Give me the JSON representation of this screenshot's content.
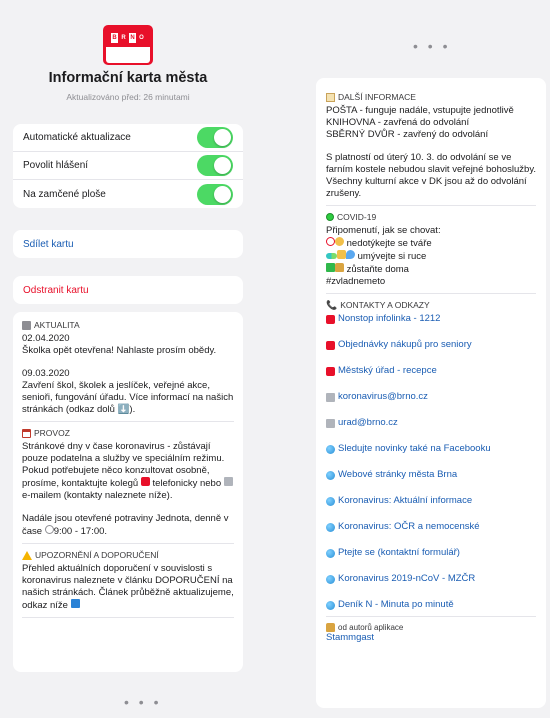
{
  "header": {
    "title": "Informační karta města",
    "updated": "Aktualizováno před: 26 minutami",
    "icon_letters": [
      "B",
      "R",
      "N",
      "O"
    ]
  },
  "settings": {
    "toggles": [
      {
        "label": "Automatické aktualizace",
        "on": true
      },
      {
        "label": "Povolit hlášení",
        "on": true
      },
      {
        "label": "Na zamčené ploše",
        "on": true
      }
    ]
  },
  "actions": {
    "share": "Sdílet kartu",
    "remove": "Odstranit kartu"
  },
  "sections": {
    "news": {
      "head": "AKTUALITA",
      "entries": [
        {
          "date": "02.04.2020",
          "text": "Školka opět otevřena! Nahlaste prosím obědy."
        },
        {
          "date": "09.03.2020",
          "text": "Zavření škol, školek a jeslíček, veřejné akce, senioři, fungování úřadu. Více informací na našich stránkách (odkaz dolů ⬇️)."
        }
      ]
    },
    "provoz": {
      "head": "PROVOZ",
      "p1": "Stránkové dny v čase koronavirus - zůstávají pouze podatelna a služby ve speciálním režimu.",
      "p2a": "Pokud potřebujete něco konzultovat osobně, prosíme, kontaktujte kolegů",
      "p2b": "telefonicky nebo",
      "p2c": "e-mailem (kontakty naleznete níže).",
      "p3a": "Nadále jsou otevřené potraviny Jednota, denně v čase",
      "p3b": "9:00 - 17:00."
    },
    "warning": {
      "head": "UPOZORNĚNÍ A DOPORUČENÍ",
      "text": "Přehled aktuálních doporučení v souvislosti s koronavirus naleznete v článku DOPORUČENÍ na našich stránkách. Článek průběžně aktualizujeme, odkaz níže"
    },
    "info": {
      "head": "DALŠÍ INFORMACE",
      "lines": [
        "POŠTA - funguje nadále, vstupujte jednotlivě",
        "KNIHOVNA - zavřená do odvolání",
        "SBĚRNÝ DVŮR - zavřený do odvolání"
      ],
      "p2": "S platností od úterý 10. 3. do odvolání se ve farním kostele nebudou slavit veřejné bohoslužby.",
      "p3": "Všechny kulturní akce v DK jsou až do odvolání zrušeny."
    },
    "covid": {
      "head": "COVID-19",
      "intro": "Připomenutí, jak se chovat:",
      "rule1": "nedotýkejte se tváře",
      "rule2": "umývejte si ruce",
      "rule3": "zůstaňte doma",
      "tag": "#zvladnemeto"
    },
    "contacts": {
      "head": "KONTAKTY A ODKAZY",
      "links": [
        {
          "icon": "tel",
          "label": "Nonstop infolinka - 1212"
        },
        {
          "icon": "tel",
          "label": "Objednávky nákupů pro seniory"
        },
        {
          "icon": "tel",
          "label": "Městský úřad - recepce"
        },
        {
          "icon": "mail",
          "label": "koronavirus@brno.cz"
        },
        {
          "icon": "mail",
          "label": "urad@brno.cz"
        },
        {
          "icon": "globe",
          "label": "Sledujte novinky také na Facebooku"
        },
        {
          "icon": "globe",
          "label": "Webové stránky města Brna"
        },
        {
          "icon": "globe",
          "label": "Koronavirus: Aktuální informace"
        },
        {
          "icon": "globe",
          "label": "Koronavirus: OČR a nemocenské"
        },
        {
          "icon": "globe",
          "label": "Ptejte se (kontaktní formulář)"
        },
        {
          "icon": "globe",
          "label": "Koronavirus 2019-nCoV - MZČR"
        },
        {
          "icon": "globe",
          "label": "Deník N - Minuta po minutě"
        }
      ]
    },
    "author": {
      "label": "od autorů aplikace",
      "link": "Stammgast"
    }
  },
  "more_dots": "• • •",
  "colors": {
    "accent_green": "#4cd964",
    "link_blue": "#1a5db3",
    "danger_red": "#e8102a"
  }
}
